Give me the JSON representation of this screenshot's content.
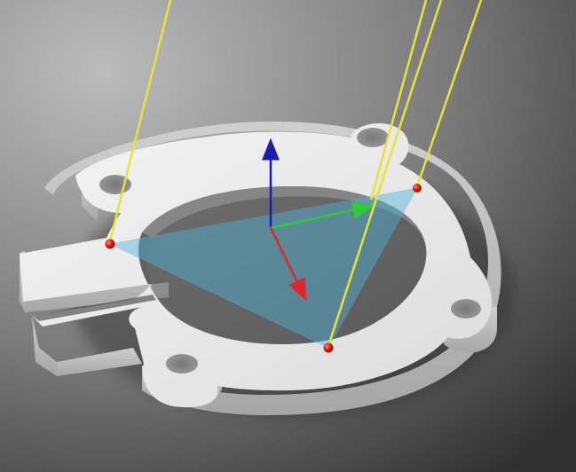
{
  "scene": {
    "objects": [
      "split-ring-part",
      "mounting-lug",
      "mounting-hole",
      "contact-point",
      "yellow-line",
      "coordinate-axes",
      "contact-plane"
    ],
    "colors": {
      "background_light": "#b9b9b9",
      "background_dark": "#2f2f2f",
      "part_top": "#f1f1f1",
      "part_side": "#bdbdbd",
      "part_shadow": "#9a9a9a",
      "contact_point": "#e01a10",
      "yellow_line": "#e8e23a",
      "axis_x": "#e0262a",
      "axis_y": "#2fc93a",
      "axis_z": "#1a1fa8",
      "plane_fill": "#4fb3d9"
    },
    "contact_points_count": 3,
    "yellow_lines_count": 4
  }
}
